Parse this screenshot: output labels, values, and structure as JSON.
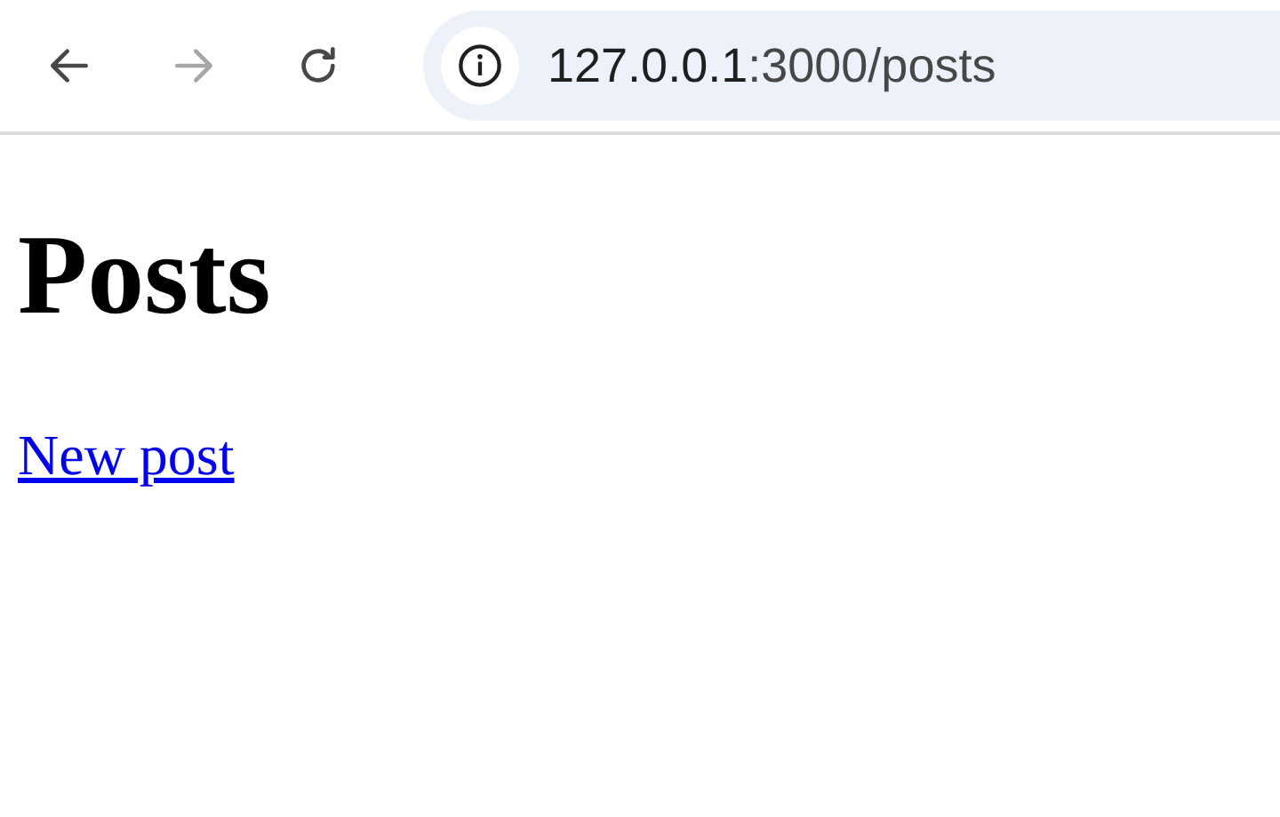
{
  "toolbar": {
    "buttons": [
      {
        "kind": "back",
        "disabled": false
      },
      {
        "kind": "forward",
        "disabled": true
      },
      {
        "kind": "reload",
        "disabled": false
      }
    ],
    "address": {
      "host": "127.0.0.1",
      "rest": ":3000/posts"
    }
  },
  "page": {
    "heading": "Posts",
    "link": "New post"
  }
}
